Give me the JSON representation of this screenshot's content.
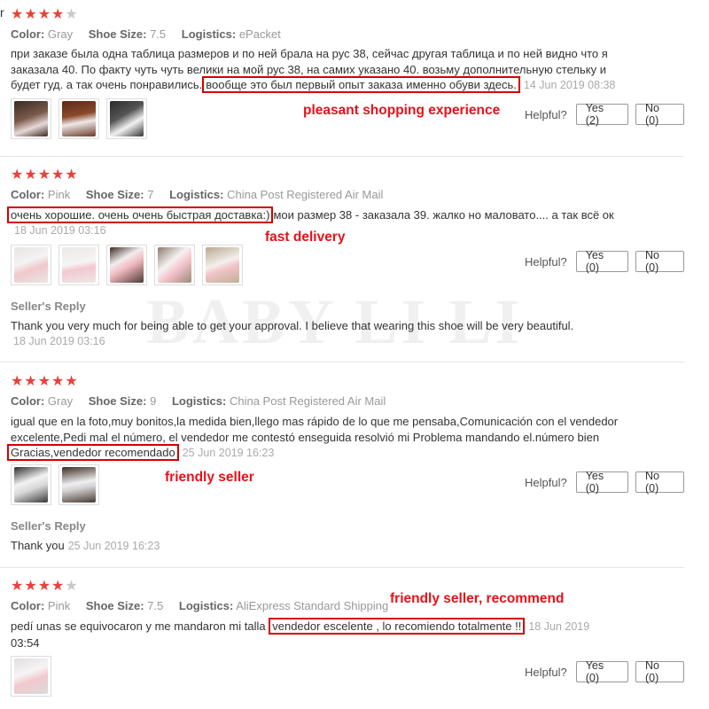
{
  "edge_char": "r",
  "watermark": "BABY LI LI",
  "labels": {
    "color": "Color:",
    "shoe_size": "Shoe Size:",
    "logistics": "Logistics:",
    "helpful": "Helpful?",
    "seller_reply": "Seller's Reply"
  },
  "colors": {
    "star_on": "#e8413b",
    "star_off": "#c8c8c8",
    "highlight_box": "#d40000",
    "annotation": "#e8101a"
  },
  "reviews": [
    {
      "rating": 4,
      "color": "Gray",
      "shoe_size": "7.5",
      "logistics": "ePacket",
      "text_line1": "при заказе была одна таблица размеров и по ней брала на рус 38, сейчас другая таблица и по ней видно что я",
      "text_line2": "заказала 40. По факту чуть чуть велики на мой рус 38, на самих указано 40. возьму дополнительную стельку и",
      "text_before": "будет гуд. а так очень понравились.",
      "text_highlight": "вообще это был первый опыт заказа именно обуви здесь.",
      "date": "14 Jun 2019 08:38",
      "annotation": "pleasant shopping experience",
      "photo_count": 3,
      "yes_label": "Yes (2)",
      "no_label": "No (0)"
    },
    {
      "rating": 5,
      "color": "Pink",
      "shoe_size": "7",
      "logistics": "China Post Registered Air Mail",
      "text_highlight": "очень хорошие. очень очень быстрая доставка:)",
      "text_after": "мои размер 38 - заказала 39. жалко но маловато.... а так всё ок",
      "date": "18 Jun 2019 03:16",
      "annotation": "fast delivery",
      "photo_count": 5,
      "yes_label": "Yes (0)",
      "no_label": "No (0)",
      "reply_text": "Thank you very much for being able to get your approval. I believe that wearing this shoe will be very beautiful.",
      "reply_date": "18 Jun 2019 03:16"
    },
    {
      "rating": 5,
      "color": "Gray",
      "shoe_size": "9",
      "logistics": "China Post Registered Air Mail",
      "text_line1": "igual que en la foto,muy bonitos,la medida bien,llego mas rápido de lo que me pensaba,Comunicación con el vendedor",
      "text_line2": "excelente,Pedi mal el número, el vendedor me contestó enseguida resolvió mi Problema mandando el.número bien",
      "text_highlight": "Gracias,vendedor recomendado",
      "date": "25 Jun 2019 16:23",
      "annotation": "friendly seller",
      "photo_count": 2,
      "yes_label": "Yes (0)",
      "no_label": "No (0)",
      "reply_text": "Thank you",
      "reply_date": "25 Jun 2019 16:23"
    },
    {
      "rating": 4,
      "color": "Pink",
      "shoe_size": "7.5",
      "logistics": "AliExpress Standard Shipping",
      "text_before": "pedí unas se equivocaron y me mandaron mi talla",
      "text_highlight": "vendedor escelente , lo recomiendo totalmente !!",
      "date_part1": "18 Jun 2019",
      "date_part2": "03:54",
      "annotation": "friendly seller, recommend",
      "photo_count": 1,
      "yes_label": "Yes (0)",
      "no_label": "No (0)"
    }
  ]
}
